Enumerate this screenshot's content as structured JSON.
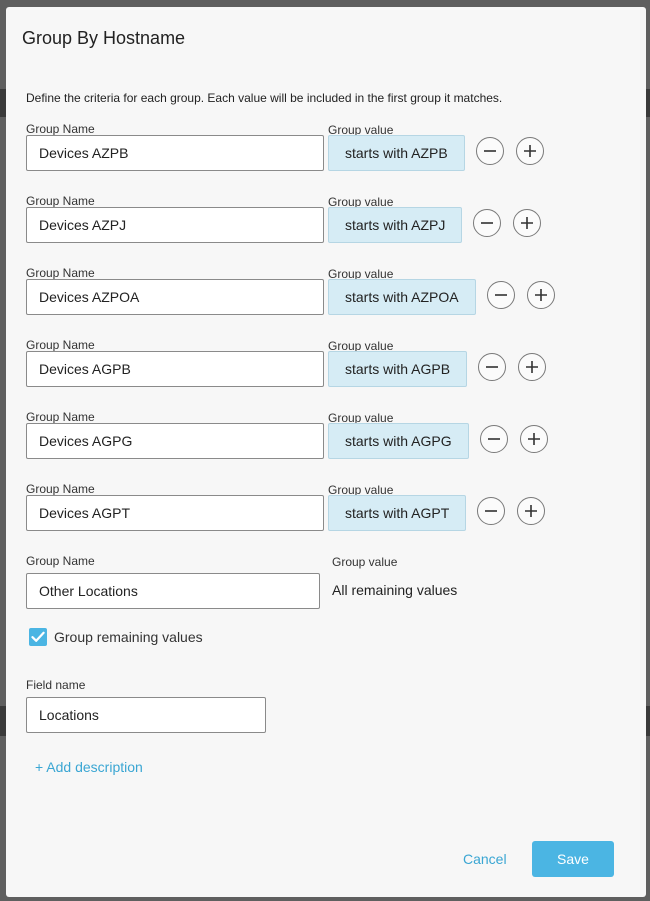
{
  "dialog": {
    "title": "Group By Hostname",
    "intro": "Define the criteria for each group. Each value will be included in the first group it matches."
  },
  "labels": {
    "group_name": "Group Name",
    "group_value": "Group value"
  },
  "groups": [
    {
      "name": "Devices AZPB",
      "value": "starts with AZPB"
    },
    {
      "name": "Devices AZPJ",
      "value": "starts with AZPJ"
    },
    {
      "name": "Devices AZPOA",
      "value": "starts with AZPOA"
    },
    {
      "name": "Devices AGPB",
      "value": "starts with AGPB"
    },
    {
      "name": "Devices AGPG",
      "value": "starts with AGPG"
    },
    {
      "name": "Devices AGPT",
      "value": "starts with AGPT"
    }
  ],
  "remaining": {
    "name": "Other Locations",
    "value_text": "All remaining values",
    "checkbox_label": "Group remaining values",
    "checked": true
  },
  "field": {
    "label": "Field name",
    "value": "Locations"
  },
  "add_description": "+ Add description",
  "footer": {
    "cancel_label": "Cancel",
    "save_label": "Save"
  },
  "colors": {
    "accent": "#4bb5e3",
    "link": "#3aa6d3",
    "pill_bg": "#d6ecf5"
  },
  "icons": {
    "remove": "minus-circle-icon",
    "add": "plus-circle-icon",
    "check": "check-icon"
  }
}
